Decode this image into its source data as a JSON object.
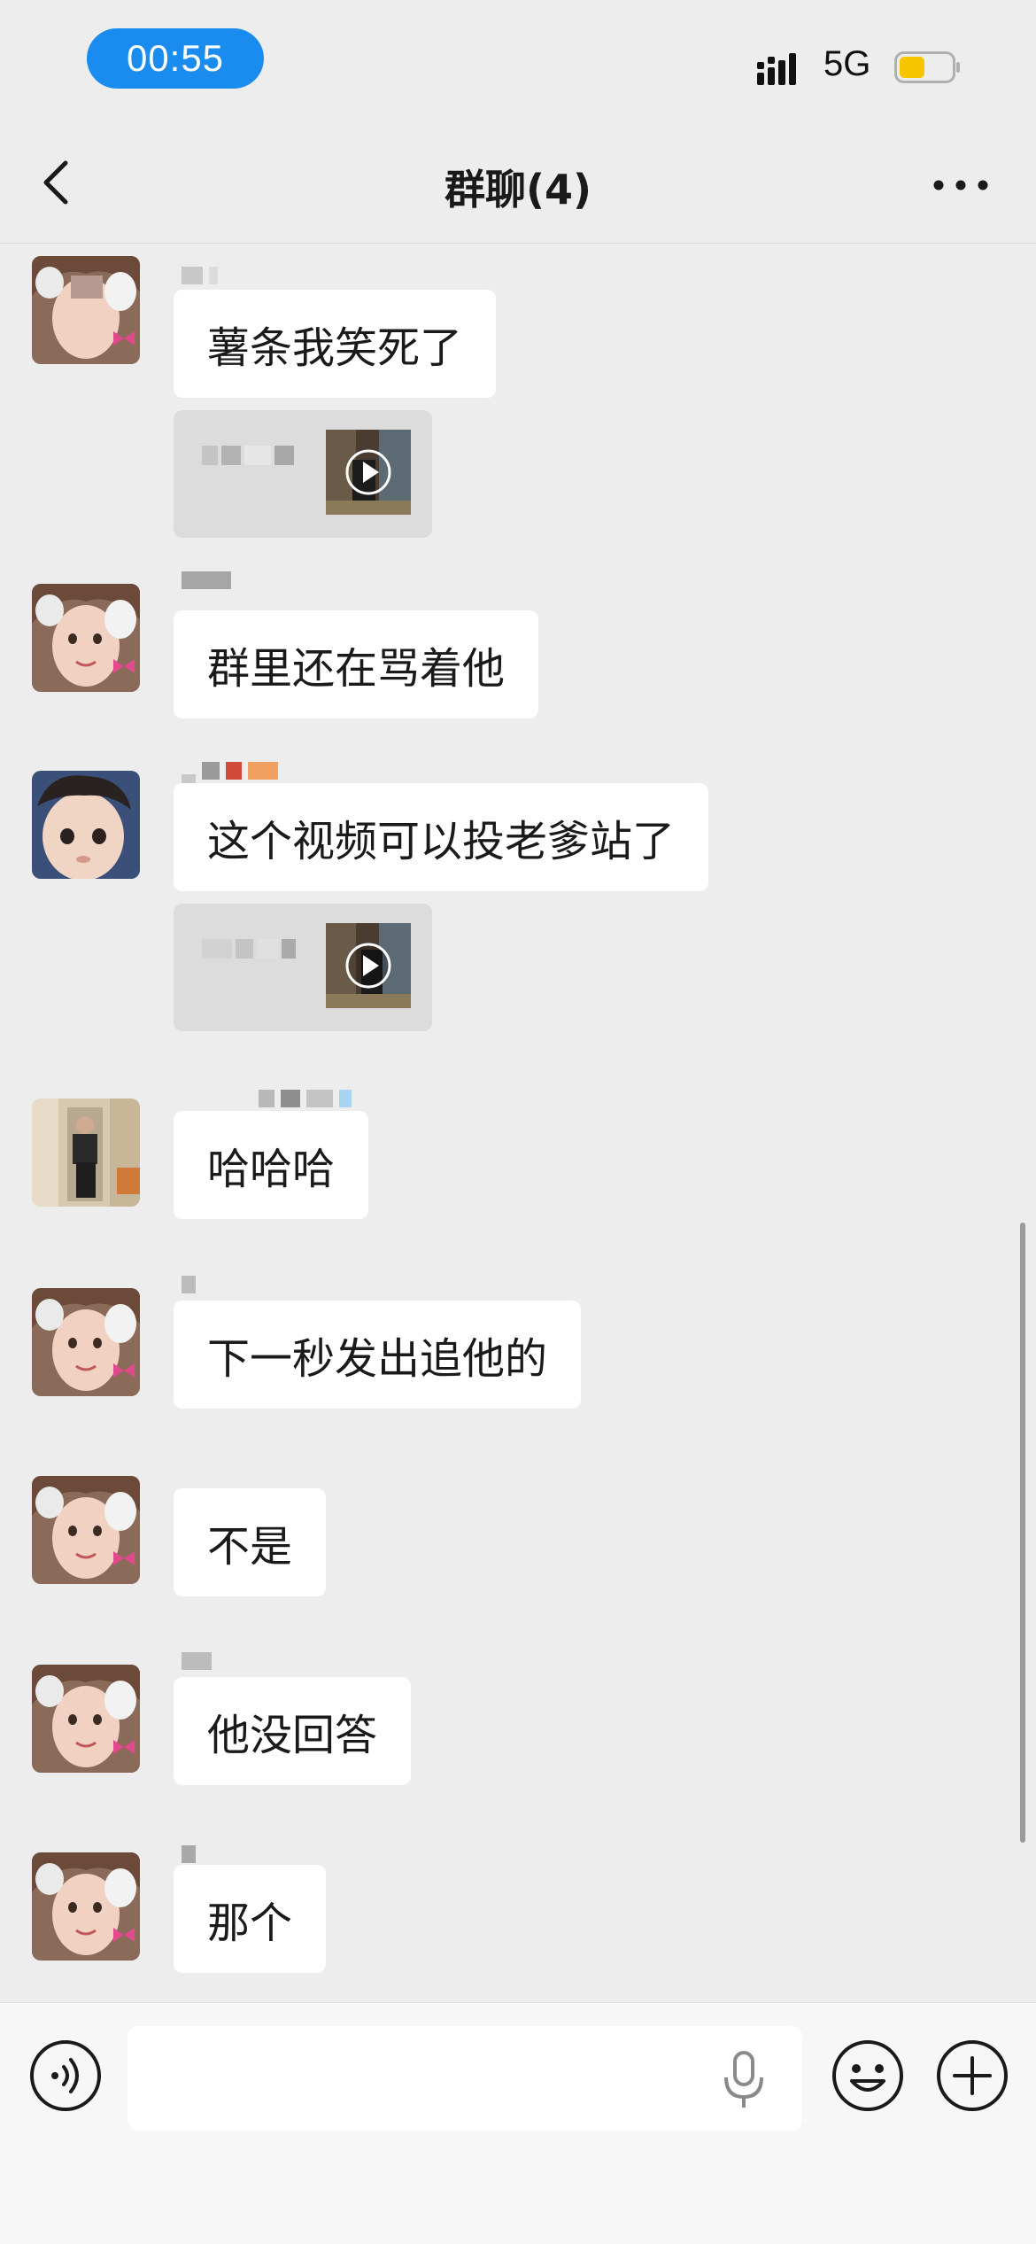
{
  "status_bar": {
    "time": "00:55",
    "network": "5G",
    "battery_color": "#f7c600"
  },
  "nav": {
    "title": "群聊(4)"
  },
  "messages": [
    {
      "text": "薯条我笑死了",
      "avatar": "girl-avatar-icon"
    },
    {
      "text": "群里还在骂着他",
      "avatar": "girl-avatar-icon"
    },
    {
      "text": "这个视频可以投老爹站了",
      "avatar": "child-avatar-icon"
    },
    {
      "text": "哈哈哈",
      "avatar": "room-avatar-icon"
    },
    {
      "text": "下一秒发出追他的",
      "avatar": "girl-avatar-icon"
    },
    {
      "text": "不是",
      "avatar": "girl-avatar-icon"
    },
    {
      "text": "他没回答",
      "avatar": "girl-avatar-icon"
    },
    {
      "text": "那个",
      "avatar": "girl-avatar-icon"
    }
  ],
  "colors": {
    "time_pill": "#1a8cf0",
    "chat_bg": "#ededed",
    "bubble": "#ffffff"
  }
}
